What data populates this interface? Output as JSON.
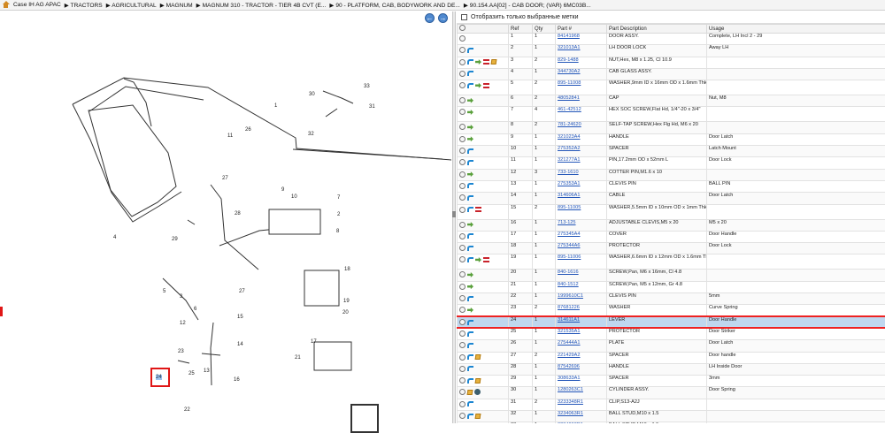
{
  "breadcrumb": [
    "Case IH AG APAC",
    "TRACTORS",
    "AGRICULTURAL",
    "MAGNUM",
    "MAGNUM 310 - TRACTOR - TIER 4B CVT (E...",
    "90 - PLATFORM, CAB, BODYWORK AND DE...",
    "90.154.AA[02] - CAB DOOR; (VAR) 6MC03B..."
  ],
  "filter": {
    "label": "Отобразить только выбранные метки"
  },
  "table": {
    "headers": [
      "",
      "Ref",
      "Qty",
      "Part #",
      "Part Description",
      "Usage"
    ],
    "rows": [
      {
        "icons": [
          "circle-icon"
        ],
        "ref": "1",
        "qty": "1",
        "part": "84141968",
        "desc": "DOOR ASSY.",
        "usage": "Complete, LH Incl 2 - 29"
      },
      {
        "icons": [
          "circle-icon",
          "blue-reload-icon"
        ],
        "ref": "2",
        "qty": "1",
        "part": "321013A1",
        "desc": "LH DOOR LOCK",
        "usage": "Away LH"
      },
      {
        "icons": [
          "circle-icon",
          "blue-reload-icon",
          "green-arrow-icon",
          "red-bars-icon",
          "box-icon"
        ],
        "ref": "3",
        "qty": "2",
        "part": "829-1488",
        "desc": "NUT,Hex, M8 x 1.25, Cl 10.9",
        "usage": ""
      },
      {
        "icons": [
          "circle-icon",
          "blue-reload-icon"
        ],
        "ref": "4",
        "qty": "1",
        "part": "344730A2",
        "desc": "CAB GLASS ASSY.",
        "usage": ""
      },
      {
        "icons": [
          "circle-icon",
          "blue-reload-icon",
          "green-arrow-icon",
          "red-bars-icon"
        ],
        "ref": "5",
        "qty": "2",
        "part": "895-11008",
        "desc": "WASHER,9mm ID x 16mm OD x 1.6mm Thk",
        "usage": ""
      },
      {
        "icons": [
          "circle-icon",
          "green-arrow-icon"
        ],
        "ref": "6",
        "qty": "2",
        "part": "48052841",
        "desc": "CAP",
        "usage": "Nut, M8"
      },
      {
        "icons": [
          "circle-icon",
          "green-arrow-icon"
        ],
        "ref": "7",
        "qty": "4",
        "part": "461-42512",
        "desc": "HEX SOC SCREW,Flat Hd, 1/4\"-20 x 3/4\"",
        "usage": ""
      },
      {
        "icons": [
          "circle-icon",
          "green-arrow-icon"
        ],
        "ref": "8",
        "qty": "2",
        "part": "781-24620",
        "desc": "SELF-TAP SCREW,Hex Flg Hd, M6 x 20",
        "usage": ""
      },
      {
        "icons": [
          "circle-icon",
          "green-arrow-icon"
        ],
        "ref": "9",
        "qty": "1",
        "part": "321023A4",
        "desc": "HANDLE",
        "usage": "Door Latch"
      },
      {
        "icons": [
          "circle-icon",
          "blue-reload-icon"
        ],
        "ref": "10",
        "qty": "1",
        "part": "275352A2",
        "desc": "SPACER",
        "usage": "Latch Mount"
      },
      {
        "icons": [
          "circle-icon",
          "blue-reload-icon"
        ],
        "ref": "11",
        "qty": "1",
        "part": "321277A1",
        "desc": "PIN,17.2mm OD x 52mm L",
        "usage": "Door Lock"
      },
      {
        "icons": [
          "circle-icon",
          "green-arrow-icon"
        ],
        "ref": "12",
        "qty": "3",
        "part": "733-1610",
        "desc": "COTTER PIN,M1.6 x 10",
        "usage": ""
      },
      {
        "icons": [
          "circle-icon",
          "blue-reload-icon"
        ],
        "ref": "13",
        "qty": "1",
        "part": "275353A1",
        "desc": "CLEVIS PIN",
        "usage": "BALL PIN"
      },
      {
        "icons": [
          "circle-icon",
          "blue-reload-icon"
        ],
        "ref": "14",
        "qty": "1",
        "part": "314606A1",
        "desc": "CABLE",
        "usage": "Door Latch"
      },
      {
        "icons": [
          "circle-icon",
          "blue-reload-icon",
          "red-bars-icon"
        ],
        "ref": "15",
        "qty": "2",
        "part": "895-11005",
        "desc": "WASHER,5.5mm ID x 10mm OD x 1mm Thk",
        "usage": ""
      },
      {
        "icons": [
          "circle-icon",
          "green-arrow-icon"
        ],
        "ref": "16",
        "qty": "1",
        "part": "713-125",
        "desc": "ADJUSTABLE CLEVIS,M5 x 20",
        "usage": "M5 x 20"
      },
      {
        "icons": [
          "circle-icon",
          "blue-reload-icon"
        ],
        "ref": "17",
        "qty": "1",
        "part": "275345A4",
        "desc": "COVER",
        "usage": "Door Handle"
      },
      {
        "icons": [
          "circle-icon",
          "blue-reload-icon"
        ],
        "ref": "18",
        "qty": "1",
        "part": "275344A6",
        "desc": "PROTECTOR",
        "usage": "Door Lock"
      },
      {
        "icons": [
          "circle-icon",
          "blue-reload-icon",
          "green-arrow-icon",
          "red-bars-icon"
        ],
        "ref": "19",
        "qty": "1",
        "part": "895-11006",
        "desc": "WASHER,6.6mm ID x 12mm OD x 1.6mm Thk",
        "usage": ""
      },
      {
        "icons": [
          "circle-icon",
          "green-arrow-icon"
        ],
        "ref": "20",
        "qty": "1",
        "part": "840-1616",
        "desc": "SCREW,Pan, M6 x 16mm, Cl 4.8",
        "usage": ""
      },
      {
        "icons": [
          "circle-icon",
          "green-arrow-icon"
        ],
        "ref": "21",
        "qty": "1",
        "part": "840-1512",
        "desc": "SCREW,Pan, M5 x 12mm, Gr 4.8",
        "usage": ""
      },
      {
        "icons": [
          "circle-icon",
          "blue-reload-icon"
        ],
        "ref": "22",
        "qty": "1",
        "part": "1999610C1",
        "desc": "CLEVIS PIN",
        "usage": "5mm"
      },
      {
        "icons": [
          "circle-icon",
          "green-arrow-icon"
        ],
        "ref": "23",
        "qty": "2",
        "part": "87681226",
        "desc": "WASHER",
        "usage": "Curve Spring"
      },
      {
        "icons": [
          "circle-icon",
          "blue-reload-icon"
        ],
        "ref": "24",
        "qty": "1",
        "part": "314611A1",
        "desc": "LEVER",
        "usage": "Door Handle"
      },
      {
        "icons": [
          "circle-icon",
          "blue-reload-icon"
        ],
        "ref": "25",
        "qty": "1",
        "part": "321535A1",
        "desc": "PROTECTOR",
        "usage": "Door Striker"
      },
      {
        "icons": [
          "circle-icon",
          "blue-reload-icon"
        ],
        "ref": "26",
        "qty": "1",
        "part": "275444A1",
        "desc": "PLATE",
        "usage": "Door Latch"
      },
      {
        "icons": [
          "circle-icon",
          "blue-reload-icon",
          "box-icon"
        ],
        "ref": "27",
        "qty": "2",
        "part": "221429A2",
        "desc": "SPACER",
        "usage": "Door handle"
      },
      {
        "icons": [
          "circle-icon",
          "blue-reload-icon"
        ],
        "ref": "28",
        "qty": "1",
        "part": "87542696",
        "desc": "HANDLE",
        "usage": "LH Inside Door"
      },
      {
        "icons": [
          "circle-icon",
          "blue-reload-icon",
          "box-icon"
        ],
        "ref": "29",
        "qty": "1",
        "part": "308633A1",
        "desc": "SPACER",
        "usage": "3mm"
      },
      {
        "icons": [
          "circle-icon",
          "box-icon",
          "dark-circle-icon"
        ],
        "ref": "30",
        "qty": "1",
        "part": "1280263C1",
        "desc": "CYLINDER ASSY.",
        "usage": "Door Spring"
      },
      {
        "icons": [
          "circle-icon",
          "blue-reload-icon"
        ],
        "ref": "31",
        "qty": "2",
        "part": "3233348R1",
        "desc": "CLIP,S13-A2J",
        "usage": ""
      },
      {
        "icons": [
          "circle-icon",
          "blue-reload-icon",
          "box-icon"
        ],
        "ref": "32",
        "qty": "1",
        "part": "3234063R1",
        "desc": "BALL STUD,M10 x 1.5",
        "usage": ""
      },
      {
        "icons": [
          "circle-icon",
          "blue-reload-icon",
          "box-icon"
        ],
        "ref": "33",
        "qty": "1",
        "part": "3234063R1",
        "desc": "BALL STUD,M10 x 1.5",
        "usage": ""
      }
    ]
  },
  "diagram": {
    "labels": [
      "1",
      "2",
      "3",
      "4",
      "5",
      "6",
      "7",
      "8",
      "9",
      "10",
      "11",
      "12",
      "13",
      "14",
      "15",
      "16",
      "17",
      "18",
      "19",
      "20",
      "21",
      "22",
      "23",
      "24",
      "25",
      "26",
      "27",
      "28",
      "29",
      "30",
      "31",
      "32",
      "33"
    ],
    "highlight_label": "24"
  },
  "navigation": {
    "back_icon": "back-arrow-icon",
    "forward_icon": "forward-arrow-icon"
  }
}
